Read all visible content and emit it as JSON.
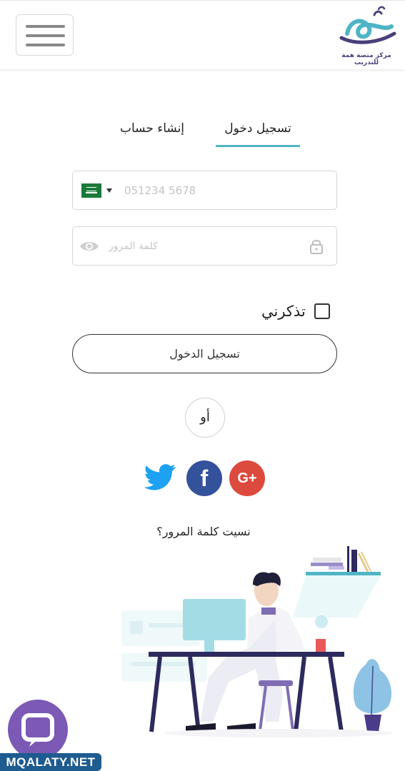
{
  "header": {
    "logo_text": "مركز منصة همة للتدريب",
    "menu_icon": "hamburger-menu-icon"
  },
  "tabs": {
    "login": "تسجيل دخول",
    "register": "إنشاء حساب",
    "active": "login"
  },
  "phone": {
    "country": "Saudi Arabia",
    "flag_icon": "saudi-flag-icon",
    "placeholder": "051234 5678",
    "value": ""
  },
  "password": {
    "placeholder": "كلمة المرور",
    "value": ""
  },
  "remember": {
    "label": "تذكرني",
    "checked": false
  },
  "login_button": "تسجيل الدخول",
  "or_label": "أو",
  "social": {
    "twitter": "twitter-icon",
    "facebook": "facebook-icon",
    "facebook_glyph": "f",
    "google": "google-plus-icon",
    "google_glyph": "G+"
  },
  "forgot_password": "نسيت كلمة المرور؟",
  "watermark": "MQALATY.NET",
  "colors": {
    "accent": "#4fb5c6",
    "facebook": "#34519b",
    "google": "#dc4a3d",
    "twitter": "#1da1f2",
    "chat": "#7b59b5",
    "watermark": "#1e5b8f"
  }
}
